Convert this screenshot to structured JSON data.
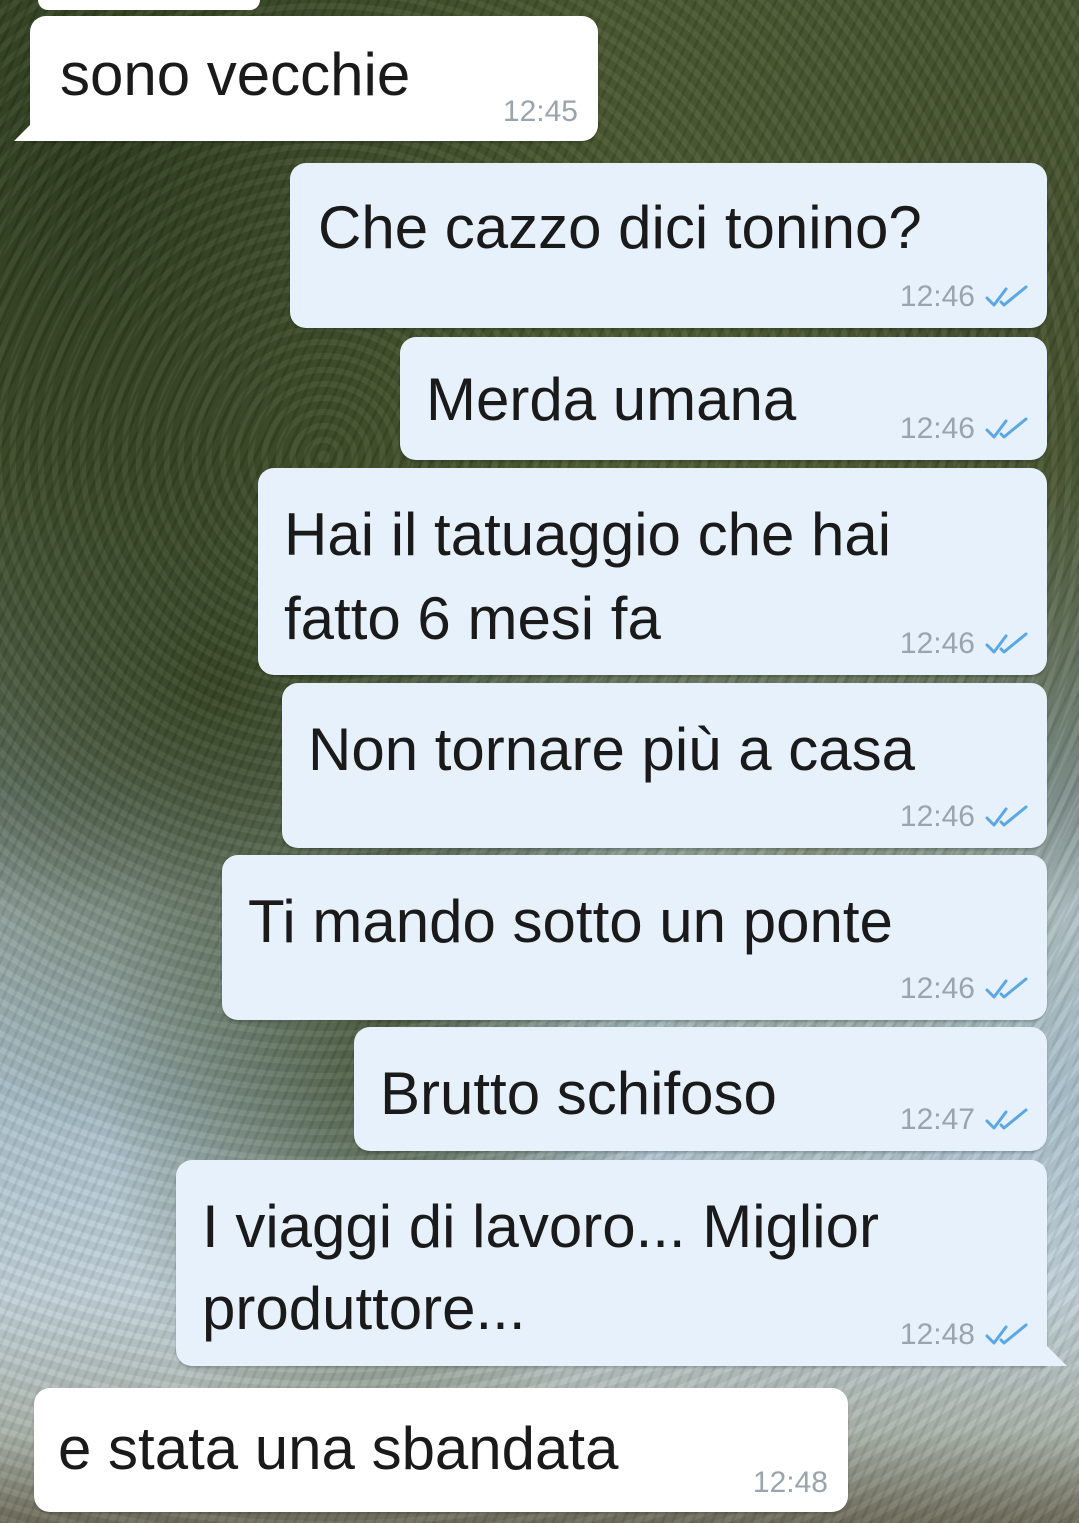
{
  "chat": {
    "messages": [
      {
        "direction": "in",
        "text": "sono vecchie",
        "time": "12:45"
      },
      {
        "direction": "out",
        "text": "Che cazzo dici tonino?",
        "time": "12:46",
        "read_ticks": "double-check-icon"
      },
      {
        "direction": "out",
        "text": "Merda umana",
        "time": "12:46",
        "read_ticks": "double-check-icon"
      },
      {
        "direction": "out",
        "text_lines": [
          "Hai il tatuaggio che hai",
          "fatto 6 mesi fa"
        ],
        "time": "12:46",
        "read_ticks": "double-check-icon"
      },
      {
        "direction": "out",
        "text": "Non tornare più a casa",
        "time": "12:46",
        "read_ticks": "double-check-icon"
      },
      {
        "direction": "out",
        "text": "Ti mando sotto un ponte",
        "time": "12:46",
        "read_ticks": "double-check-icon"
      },
      {
        "direction": "out",
        "text": "Brutto schifoso",
        "time": "12:47",
        "read_ticks": "double-check-icon"
      },
      {
        "direction": "out",
        "text_lines": [
          "I viaggi di lavoro... Miglior",
          "produttore..."
        ],
        "time": "12:48",
        "read_ticks": "double-check-icon"
      },
      {
        "direction": "in",
        "text": "e stata una sbandata",
        "time": "12:48"
      }
    ]
  },
  "colors": {
    "incoming_bubble": "#ffffff",
    "outgoing_bubble": "#e6f1fb",
    "text": "#1a1a1a",
    "timestamp": "#9aa4ad",
    "read_ticks": "#5aa6e6"
  }
}
